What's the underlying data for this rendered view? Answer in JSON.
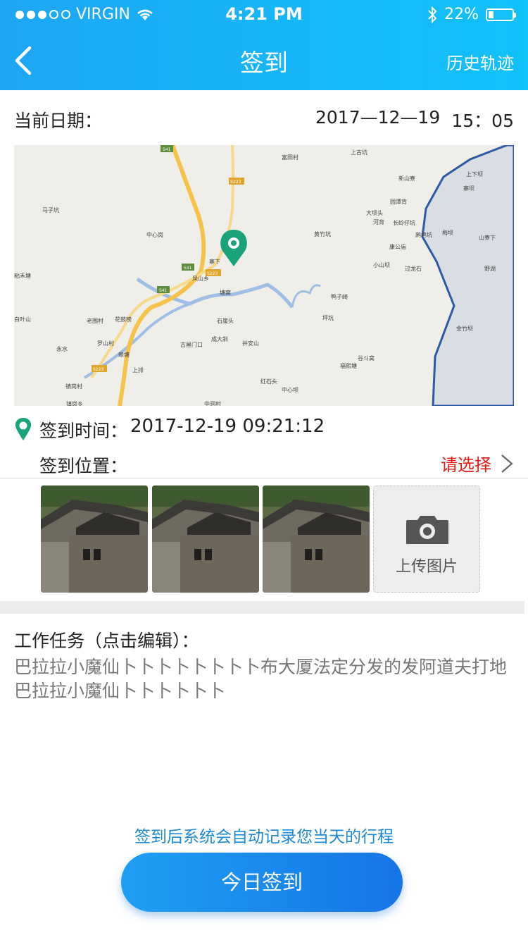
{
  "status_bar": {
    "carrier": "VIRGIN",
    "time": "4:21 PM",
    "battery": "22%",
    "signal_filled": 3,
    "signal_total": 5
  },
  "nav": {
    "title": "签到",
    "right_action": "历史轨迹"
  },
  "date_row": {
    "label": "当前日期：",
    "date": "2017—12—19",
    "time": "15：05"
  },
  "map": {
    "labels": [
      "马子坑",
      "中心岗",
      "粘禾塘",
      "白叶山",
      "老围村",
      "花鼓榜",
      "罗山村",
      "永水",
      "赖塘",
      "镇岗村",
      "上排",
      "凤山乡",
      "寨下",
      "塘窝",
      "石崖头",
      "成大斜",
      "古屋门口",
      "井安山",
      "坪坑",
      "谷斗窝",
      "福熙塘",
      "红石头",
      "中心坝",
      "中洞村",
      "镇岗乡",
      "富田村",
      "上古坑",
      "新山寮",
      "园潭背",
      "大坝头",
      "河背",
      "长岭仔坑",
      "黄竹坑",
      "康公庙",
      "小山坝",
      "过龙石",
      "鸭子崎",
      "鹧鸪坑",
      "梅坝",
      "上下坝",
      "寨坝",
      "山寮下",
      "野湖",
      "金竹坝",
      "S41",
      "S223"
    ]
  },
  "checkin": {
    "time_label": "签到时间：",
    "time_value": "2017-12-19 09:21:12",
    "location_label": "签到位置：",
    "choose": "请选择"
  },
  "upload": {
    "label": "上传图片"
  },
  "task": {
    "title": "工作任务（点击编辑）：",
    "body": "巴拉拉小魔仙卜卜卜卜卜卜卜卜布大厦法定分发的发阿道夫打地巴拉拉小魔仙卜卜卜卜卜卜"
  },
  "footer": {
    "hint": "签到后系统会自动记录您当天的行程",
    "button": "今日签到"
  },
  "colors": {
    "accent": "#1ea6f4",
    "warning": "#e21b14",
    "pin": "#1aa37a"
  }
}
